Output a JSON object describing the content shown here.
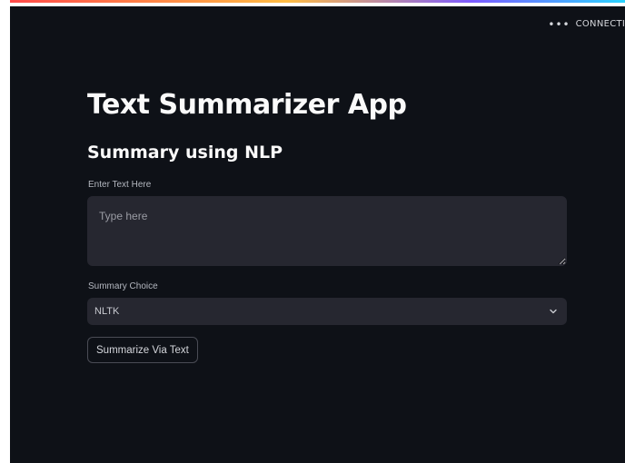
{
  "header": {
    "status_dots": "•••",
    "status_text": "CONNECTING"
  },
  "main": {
    "title": "Text Summarizer App",
    "subtitle": "Summary using NLP",
    "text_input": {
      "label": "Enter Text Here",
      "placeholder": "Type here",
      "value": ""
    },
    "summary_choice": {
      "label": "Summary Choice",
      "selected": "NLTK",
      "icon": "chevron-down-icon"
    },
    "submit_button": {
      "label": "Summarize Via Text"
    }
  },
  "colors": {
    "background": "#0e1117",
    "input_bg": "#262730",
    "text": "#fafafa",
    "label": "#b4b8c0"
  }
}
